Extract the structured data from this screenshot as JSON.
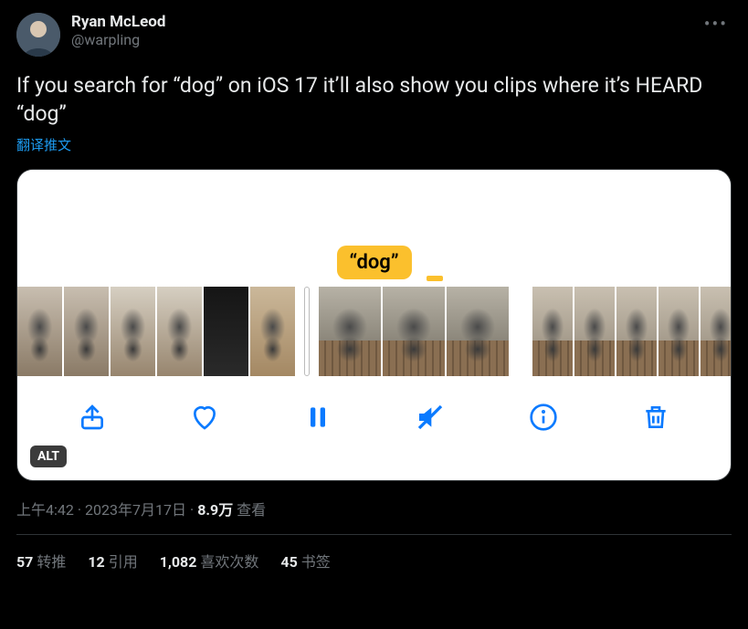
{
  "author": {
    "name": "Ryan McLeod",
    "handle": "@warpling"
  },
  "more_label": "...",
  "body": "If you search for “dog” on iOS 17 it’ll also show you clips where it’s HEARD “dog”",
  "translate": "翻译推文",
  "media": {
    "chip": "“dog”",
    "alt_badge": "ALT",
    "buttons": {
      "share": "share-icon",
      "like": "heart-icon",
      "pause": "pause-icon",
      "mute": "mute-icon",
      "info": "info-icon",
      "delete": "trash-icon"
    }
  },
  "meta": {
    "time": "上午4:42",
    "date": "2023年7月17日",
    "views_count": "8.9万",
    "views_label": " 查看"
  },
  "stats": {
    "retweet": {
      "count": "57",
      "label": "转推"
    },
    "quote": {
      "count": "12",
      "label": "引用"
    },
    "like": {
      "count": "1,082",
      "label": "喜欢次数"
    },
    "bookmark": {
      "count": "45",
      "label": "书签"
    }
  }
}
